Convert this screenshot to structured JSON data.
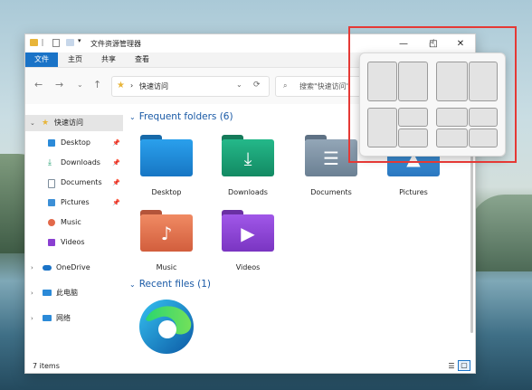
{
  "window": {
    "title": "文件资源管理器",
    "controls": {
      "minimize": "—",
      "maximize": "□",
      "close": "✕"
    }
  },
  "ribbon": {
    "tabs": [
      "文件",
      "主页",
      "共享",
      "查看"
    ]
  },
  "nav": {
    "back": "←",
    "forward": "→",
    "dropdown": "⌄",
    "up": "↑",
    "address_separator": "›",
    "address_path": "快速访问",
    "refresh": "⟳",
    "search_placeholder": "搜索\"快速访问\""
  },
  "sidebar": {
    "quick_access": "快速访问",
    "items": [
      {
        "label": "Desktop",
        "icon": "desktop-icon",
        "color": "#2b8ad8"
      },
      {
        "label": "Downloads",
        "icon": "download-icon",
        "color": "#1e9e6e"
      },
      {
        "label": "Documents",
        "icon": "documents-icon",
        "color": "#7d8d9c"
      },
      {
        "label": "Pictures",
        "icon": "pictures-icon",
        "color": "#3c8fd6"
      },
      {
        "label": "Music",
        "icon": "music-icon",
        "color": "#e2694a"
      },
      {
        "label": "Videos",
        "icon": "videos-icon",
        "color": "#8a3fd1"
      }
    ],
    "onedrive": "OneDrive",
    "this_pc": "此电脑",
    "network": "网络"
  },
  "content": {
    "frequent_title": "Frequent folders (6)",
    "recent_title": "Recent files (1)",
    "folders": [
      {
        "label": "Desktop",
        "color": "#1f8bd6",
        "tab": "#1769a8",
        "glyph": ""
      },
      {
        "label": "Downloads",
        "color": "#1ea77a",
        "tab": "#157a5a",
        "glyph": "⤓"
      },
      {
        "label": "Documents",
        "color": "#7f93a5",
        "tab": "#5e7184",
        "glyph": "☰"
      },
      {
        "label": "Pictures",
        "color": "#3a91d8",
        "tab": "#2a6ca6",
        "glyph": "▲"
      },
      {
        "label": "Music",
        "color": "#e5734f",
        "tab": "#b4543a",
        "glyph": "♪"
      },
      {
        "label": "Videos",
        "color": "#8e44d6",
        "tab": "#6a30a3",
        "glyph": "▶"
      }
    ]
  },
  "status": {
    "items_count": "7 items"
  }
}
